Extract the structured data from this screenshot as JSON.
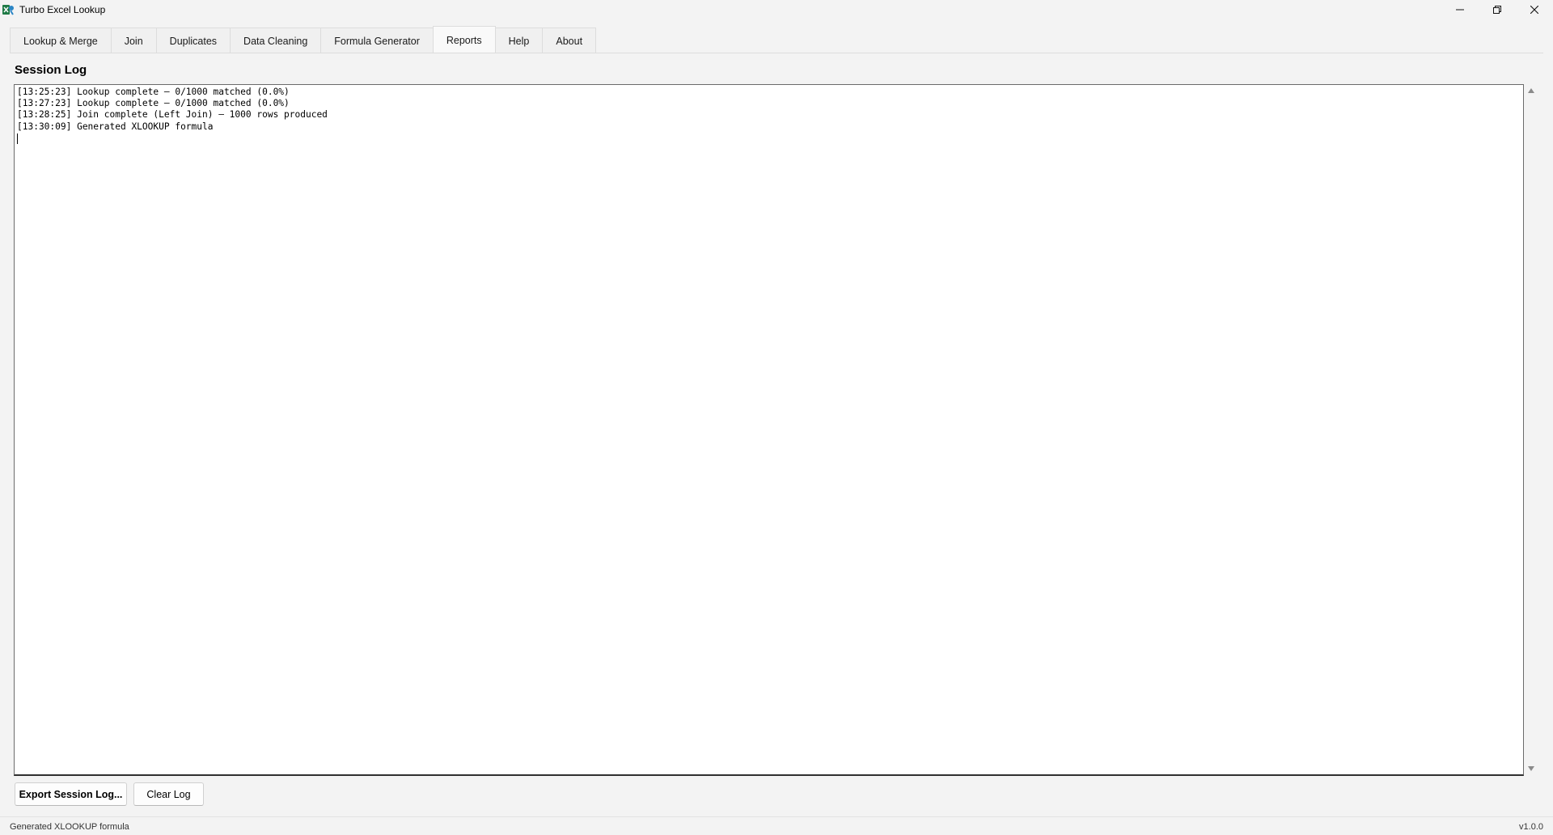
{
  "window": {
    "title": "Turbo Excel Lookup",
    "icon": "turbo-excel-lookup-app-icon",
    "controls": [
      "minimize-icon",
      "restore-icon",
      "close-icon"
    ]
  },
  "tabs": [
    {
      "label": "Lookup & Merge",
      "active": false
    },
    {
      "label": "Join",
      "active": false
    },
    {
      "label": "Duplicates",
      "active": false
    },
    {
      "label": "Data Cleaning",
      "active": false
    },
    {
      "label": "Formula Generator",
      "active": false
    },
    {
      "label": "Reports",
      "active": true
    },
    {
      "label": "Help",
      "active": false
    },
    {
      "label": "About",
      "active": false
    }
  ],
  "main": {
    "section_title": "Session Log",
    "log_lines": [
      "[13:25:23] Lookup complete — 0/1000 matched (0.0%)",
      "[13:27:23] Lookup complete — 0/1000 matched (0.0%)",
      "[13:28:25] Join complete (Left Join) — 1000 rows produced",
      "[13:30:09] Generated XLOOKUP formula"
    ],
    "buttons": {
      "export_label": "Export Session Log...",
      "clear_label": "Clear Log"
    }
  },
  "statusbar": {
    "message": "Generated XLOOKUP formula",
    "version": "v1.0.0"
  },
  "colors": {
    "background": "#f3f3f3",
    "log_background": "#ffffff",
    "border": "#6b6b6b"
  }
}
